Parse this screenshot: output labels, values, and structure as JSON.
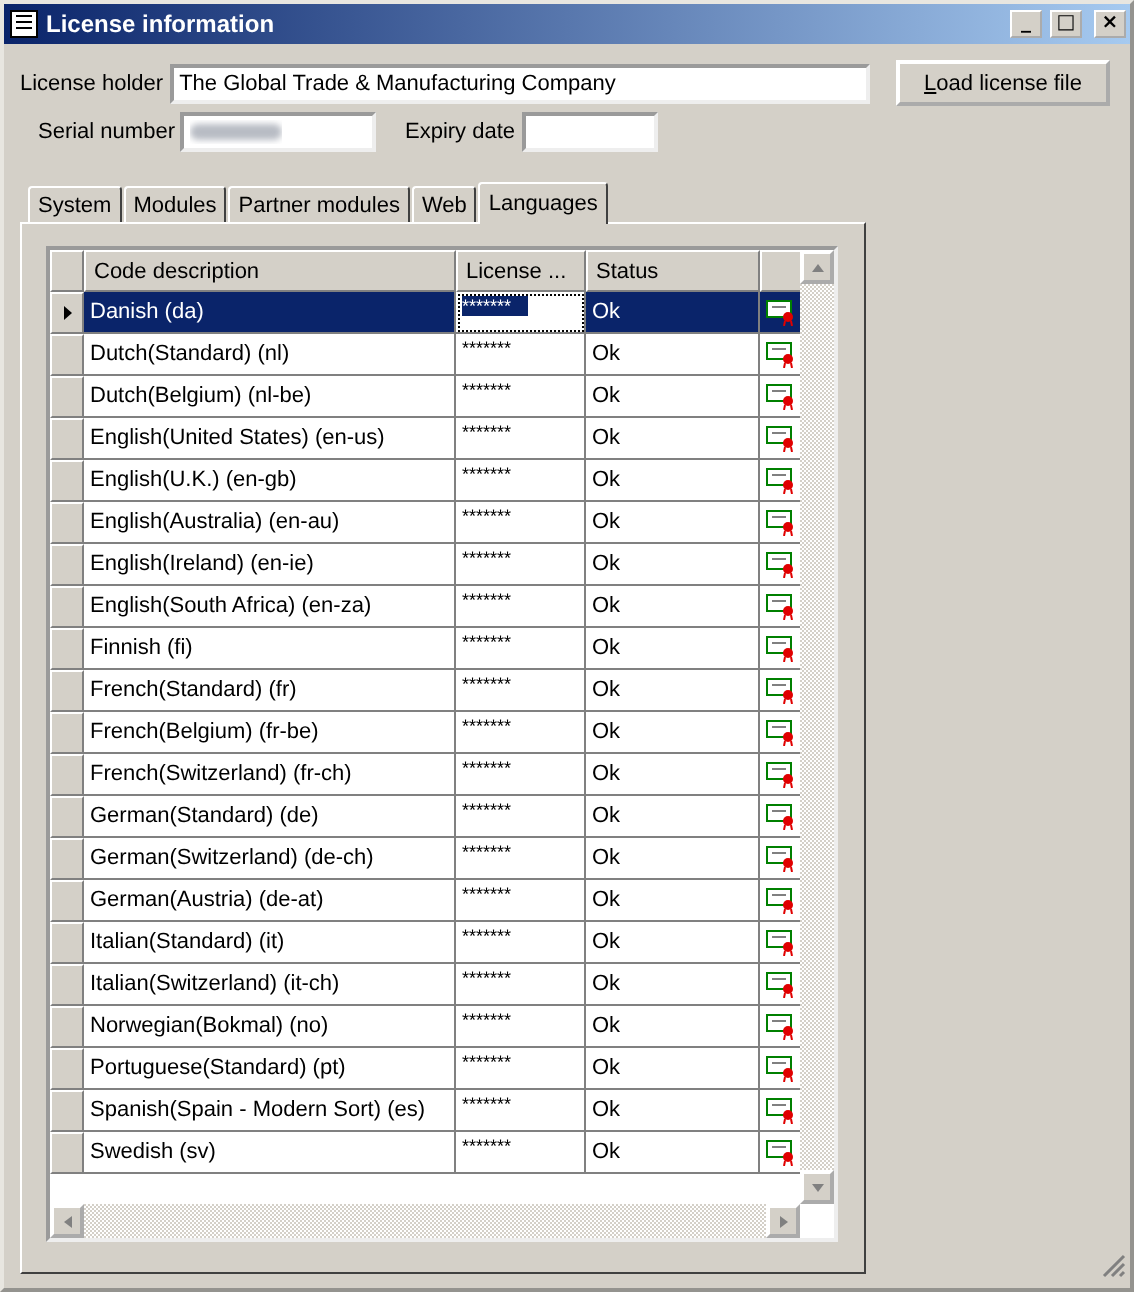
{
  "window": {
    "title": "License information",
    "controls": [
      "_",
      "□",
      "×"
    ]
  },
  "license_holder": {
    "label": "License holder",
    "value": "The Global Trade & Manufacturing Company"
  },
  "load_button": {
    "label": "Load license file"
  },
  "serial_number": {
    "label": "Serial number"
  },
  "expiry_date": {
    "label": "Expiry date"
  },
  "tabs": [
    {
      "label": "System",
      "selected": false
    },
    {
      "label": "Modules",
      "selected": false
    },
    {
      "label": "Partner modules",
      "selected": false
    },
    {
      "label": "Web",
      "selected": false
    },
    {
      "label": "Languages",
      "selected": true
    }
  ],
  "table": {
    "columns": [
      "Code description",
      "License ...",
      "Status"
    ],
    "rows": [
      {
        "code": "Danish (da)",
        "license": "*******",
        "status": "Ok",
        "selected": true
      },
      {
        "code": "Dutch(Standard) (nl)",
        "license": "*******",
        "status": "Ok",
        "selected": false
      },
      {
        "code": "Dutch(Belgium) (nl-be)",
        "license": "*******",
        "status": "Ok",
        "selected": false
      },
      {
        "code": "English(United States) (en-us)",
        "license": "*******",
        "status": "Ok",
        "selected": false
      },
      {
        "code": "English(U.K.)  (en-gb)",
        "license": "*******",
        "status": "Ok",
        "selected": false
      },
      {
        "code": "English(Australia)  (en-au)",
        "license": "*******",
        "status": "Ok",
        "selected": false
      },
      {
        "code": "English(Ireland) (en-ie)",
        "license": "*******",
        "status": "Ok",
        "selected": false
      },
      {
        "code": "English(South Africa) (en-za)",
        "license": "*******",
        "status": "Ok",
        "selected": false
      },
      {
        "code": "Finnish (fi)",
        "license": "*******",
        "status": "Ok",
        "selected": false
      },
      {
        "code": "French(Standard) (fr)",
        "license": "*******",
        "status": "Ok",
        "selected": false
      },
      {
        "code": "French(Belgium) (fr-be)",
        "license": "*******",
        "status": "Ok",
        "selected": false
      },
      {
        "code": "French(Switzerland) (fr-ch)",
        "license": "*******",
        "status": "Ok",
        "selected": false
      },
      {
        "code": "German(Standard) (de)",
        "license": "*******",
        "status": "Ok",
        "selected": false
      },
      {
        "code": "German(Switzerland) (de-ch)",
        "license": "*******",
        "status": "Ok",
        "selected": false
      },
      {
        "code": "German(Austria) (de-at)",
        "license": "*******",
        "status": "Ok",
        "selected": false
      },
      {
        "code": "Italian(Standard) (it)",
        "license": "*******",
        "status": "Ok",
        "selected": false
      },
      {
        "code": "Italian(Switzerland) (it-ch)",
        "license": "*******",
        "status": "Ok",
        "selected": false
      },
      {
        "code": "Norwegian(Bokmal) (no)",
        "license": "*******",
        "status": "Ok",
        "selected": false
      },
      {
        "code": "Portuguese(Standard) (pt)",
        "license": "*******",
        "status": "Ok",
        "selected": false
      },
      {
        "code": "Spanish(Spain - Modern Sort) (es)",
        "license": "*******",
        "status": "Ok",
        "selected": false
      },
      {
        "code": "Swedish (sv)",
        "license": "*******",
        "status": "Ok",
        "selected": false
      }
    ]
  }
}
